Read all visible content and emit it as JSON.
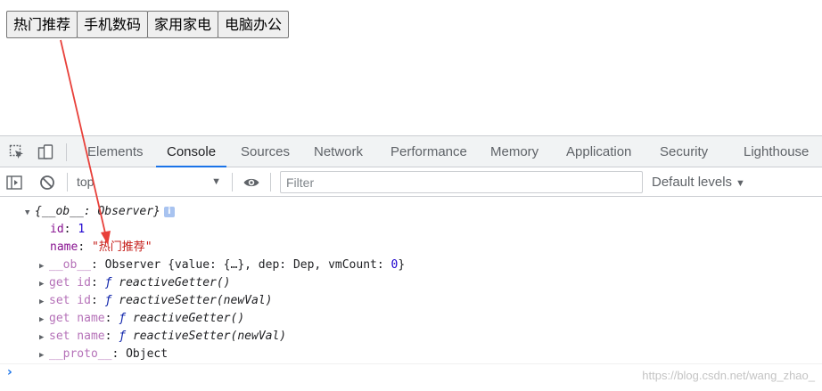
{
  "page": {
    "buttons": [
      "热门推荐",
      "手机数码",
      "家用家电",
      "电脑办公"
    ]
  },
  "devtools": {
    "tabs": [
      "Elements",
      "Console",
      "Sources",
      "Network",
      "Performance",
      "Memory",
      "Application",
      "Security",
      "Lighthouse"
    ],
    "active_tab": "Console",
    "toolbar": {
      "context": "top",
      "filter_placeholder": "Filter",
      "levels": "Default levels"
    },
    "console": {
      "object_summary": "{__ob__: Observer}",
      "info_badge": "i",
      "id_key": "id",
      "id_value": "1",
      "name_key": "name",
      "name_value": "\"热门推荐\"",
      "ob_key": "__ob__",
      "ob_text_pre": "Observer {value: {…}, dep: Dep, vmCount: ",
      "ob_vmcount": "0",
      "ob_text_post": "}",
      "get_id_key": "get id",
      "get_id_fn": "reactiveGetter()",
      "set_id_key": "set id",
      "set_id_fn": "reactiveSetter(newVal)",
      "get_name_key": "get name",
      "get_name_fn": "reactiveGetter()",
      "set_name_key": "set name",
      "set_name_fn": "reactiveSetter(newVal)",
      "proto_key": "__proto__",
      "proto_value": "Object",
      "fn_symbol": "ƒ"
    },
    "prompt_symbol": "›",
    "watermark": "https://blog.csdn.net/wang_zhao_"
  },
  "colors": {
    "accent": "#1a73e8",
    "annotation_arrow": "#e8403a"
  }
}
